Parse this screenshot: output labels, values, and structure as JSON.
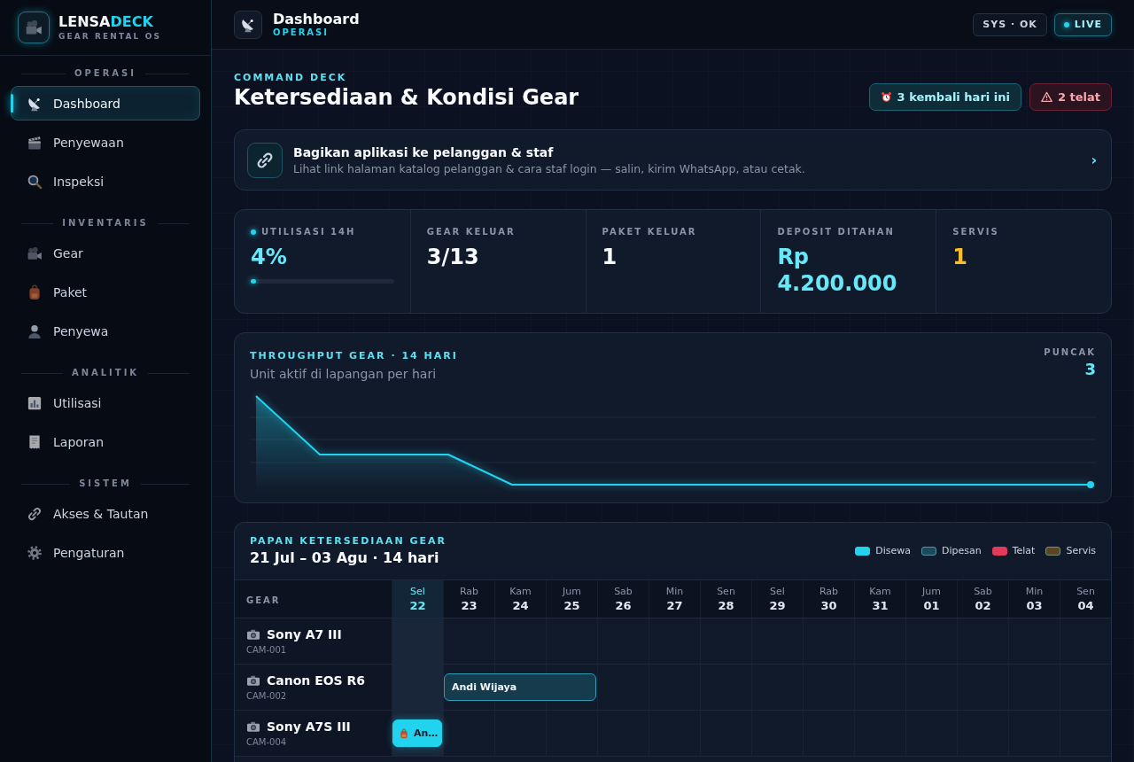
{
  "sidebar": {
    "brand": {
      "name_lead": "LENSA",
      "name_accent": "DECK",
      "tagline": "GEAR RENTAL OS"
    },
    "sections": [
      {
        "title": "OPERASI",
        "items": [
          {
            "label": "Dashboard",
            "selected": true
          },
          {
            "label": "Penyewaan",
            "selected": false
          },
          {
            "label": "Inspeksi",
            "selected": false
          }
        ]
      },
      {
        "title": "INVENTARIS",
        "items": [
          {
            "label": "Gear",
            "selected": false
          },
          {
            "label": "Paket",
            "selected": false
          },
          {
            "label": "Penyewa",
            "selected": false
          }
        ]
      },
      {
        "title": "ANALITIK",
        "items": [
          {
            "label": "Utilisasi",
            "selected": false
          },
          {
            "label": "Laporan",
            "selected": false
          }
        ]
      },
      {
        "title": "SISTEM",
        "items": [
          {
            "label": "Akses & Tautan",
            "selected": false
          },
          {
            "label": "Pengaturan",
            "selected": false
          }
        ]
      }
    ]
  },
  "topbar": {
    "title": "Dashboard",
    "subtitle": "OPERASI",
    "system_status": "SYS · OK",
    "live_label": "LIVE"
  },
  "header": {
    "eyebrow": "COMMAND DECK",
    "title": "Ketersediaan & Kondisi Gear",
    "chips": [
      {
        "kind": "returns",
        "text": "3 kembali hari ini"
      },
      {
        "kind": "late",
        "text": "2 telat"
      }
    ]
  },
  "share_banner": {
    "title": "Bagikan aplikasi ke pelanggan & staf",
    "description": "Lihat link halaman katalog pelanggan & cara staf login — salin, kirim WhatsApp, atau cetak.",
    "chevron": "›"
  },
  "stats": [
    {
      "kind": "meter",
      "label": "UTILISASI 14H",
      "value": "4%",
      "color": "#67e8f9",
      "level": 0.04
    },
    {
      "kind": "plain",
      "label": "GEAR KELUAR",
      "value": "3/13",
      "color": "#f8fafc"
    },
    {
      "kind": "plain",
      "label": "PAKET KELUAR",
      "value": "1",
      "color": "#f8fafc"
    },
    {
      "kind": "plain",
      "label": "DEPOSIT DITAHAN",
      "value": "Rp 4.200.000",
      "color": "#67e8f9"
    },
    {
      "kind": "plain",
      "label": "SERVIS",
      "value": "1",
      "color": "#fbbf24"
    }
  ],
  "throughput": {
    "title": "THROUGHPUT GEAR · 14 HARI",
    "subtitle": "Unit aktif di lapangan per hari",
    "peak_label": "PUNCAK",
    "peak_value": "3"
  },
  "availability": {
    "title": "PAPAN KETERSEDIAAN GEAR",
    "range": "21 Jul – 03 Agu · 14 hari",
    "legend": [
      {
        "kind": "solid",
        "label": "Disewa",
        "color": "#22d3ee"
      },
      {
        "kind": "outlined",
        "label": "Dipesan",
        "color": "#1b4a5e"
      },
      {
        "kind": "solid",
        "label": "Telat",
        "color": "#e23b5a"
      },
      {
        "kind": "outlined",
        "label": "Servis",
        "color": "#5c4520"
      }
    ],
    "gear_heading": "GEAR",
    "days": [
      {
        "weekday": "Sel",
        "date": "22",
        "selected": true
      },
      {
        "weekday": "Rab",
        "date": "23",
        "selected": false
      },
      {
        "weekday": "Kam",
        "date": "24",
        "selected": false
      },
      {
        "weekday": "Jum",
        "date": "25",
        "selected": false
      },
      {
        "weekday": "Sab",
        "date": "26",
        "selected": false
      },
      {
        "weekday": "Min",
        "date": "27",
        "selected": false
      },
      {
        "weekday": "Sen",
        "date": "28",
        "selected": false
      },
      {
        "weekday": "Sel",
        "date": "29",
        "selected": false
      },
      {
        "weekday": "Rab",
        "date": "30",
        "selected": false
      },
      {
        "weekday": "Kam",
        "date": "31",
        "selected": false
      },
      {
        "weekday": "Jum",
        "date": "01",
        "selected": false
      },
      {
        "weekday": "Sab",
        "date": "02",
        "selected": false
      },
      {
        "weekday": "Min",
        "date": "03",
        "selected": false
      },
      {
        "weekday": "Sen",
        "date": "04",
        "selected": false
      }
    ],
    "rows": [
      {
        "name": "Sony A7 III",
        "code": "CAM-001",
        "cells": [
          {
            "kind": "free"
          },
          {
            "kind": "free"
          },
          {
            "kind": "free"
          },
          {
            "kind": "free"
          },
          {
            "kind": "free"
          },
          {
            "kind": "free"
          },
          {
            "kind": "free"
          },
          {
            "kind": "free"
          },
          {
            "kind": "free"
          },
          {
            "kind": "free"
          },
          {
            "kind": "free"
          },
          {
            "kind": "free"
          },
          {
            "kind": "free"
          },
          {
            "kind": "free"
          }
        ]
      },
      {
        "name": "Canon EOS R6",
        "code": "CAM-002",
        "cells": [
          {
            "kind": "free"
          },
          {
            "kind": "booked",
            "label": "Andi Wijaya",
            "package": false
          },
          {
            "kind": "continued"
          },
          {
            "kind": "continued"
          },
          {
            "kind": "free"
          },
          {
            "kind": "free"
          },
          {
            "kind": "free"
          },
          {
            "kind": "free"
          },
          {
            "kind": "free"
          },
          {
            "kind": "free"
          },
          {
            "kind": "free"
          },
          {
            "kind": "free"
          },
          {
            "kind": "free"
          },
          {
            "kind": "free"
          }
        ]
      },
      {
        "name": "Sony A7S III",
        "code": "CAM-004",
        "cells": [
          {
            "kind": "rented",
            "label": "An…",
            "package": true
          },
          {
            "kind": "free"
          },
          {
            "kind": "free"
          },
          {
            "kind": "free"
          },
          {
            "kind": "free"
          },
          {
            "kind": "free"
          },
          {
            "kind": "free"
          },
          {
            "kind": "free"
          },
          {
            "kind": "free"
          },
          {
            "kind": "free"
          },
          {
            "kind": "free"
          },
          {
            "kind": "free"
          },
          {
            "kind": "free"
          },
          {
            "kind": "free"
          }
        ]
      }
    ]
  }
}
